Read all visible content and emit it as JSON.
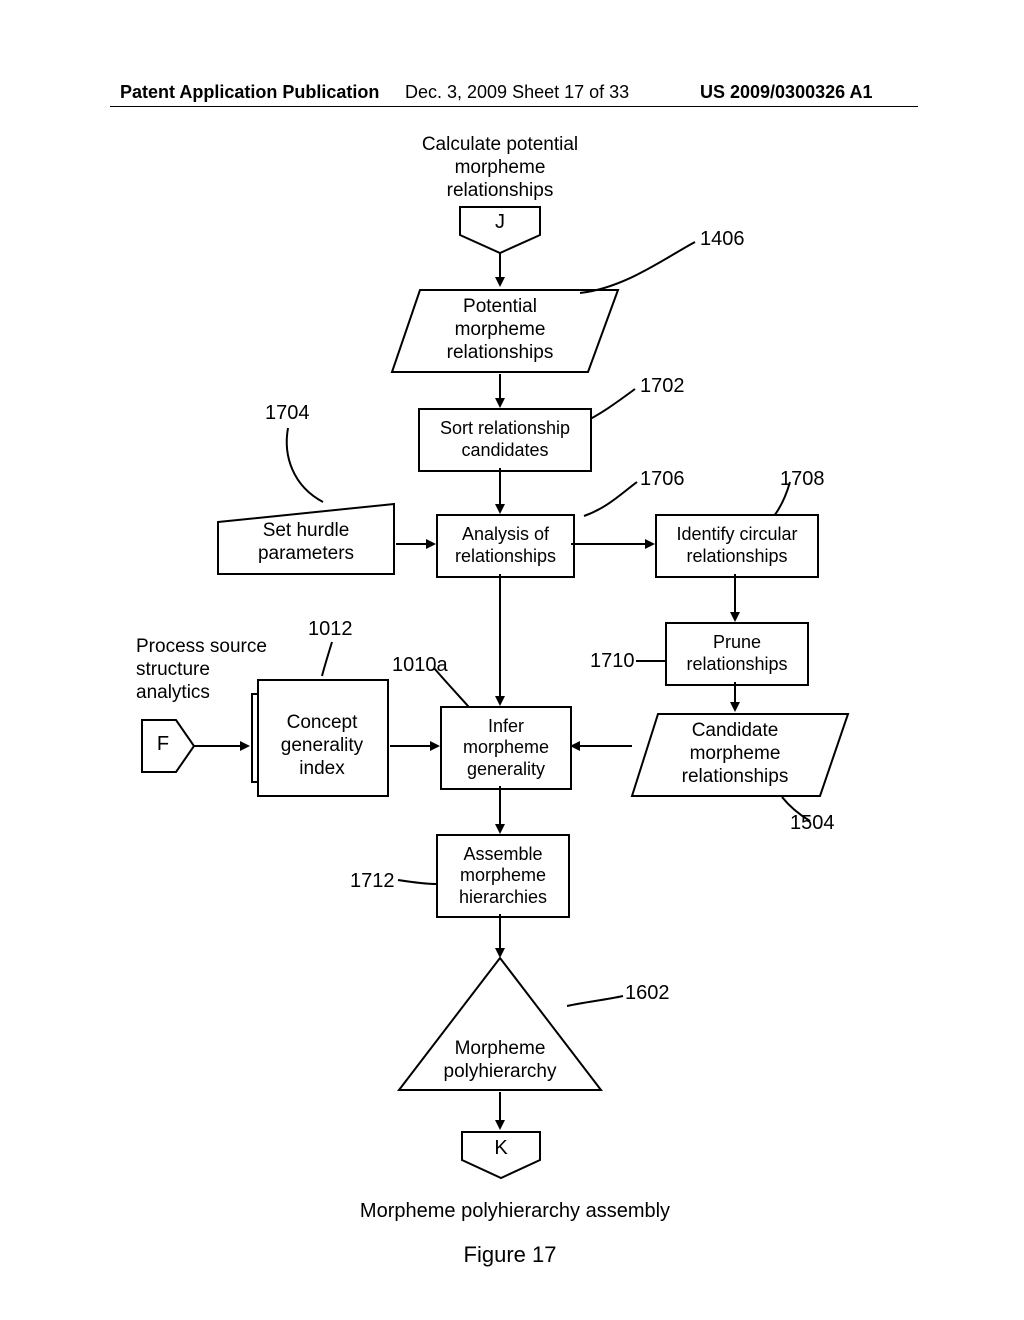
{
  "header": {
    "left": "Patent Application Publication",
    "mid": "Dec. 3, 2009   Sheet 17 of 33",
    "right": "US 2009/0300326 A1"
  },
  "nodes": {
    "title_top": "Calculate potential\nmorpheme\nrelationships",
    "conn_J": "J",
    "potential_rel": "Potential\nmorpheme\nrelationships",
    "sort_cand": "Sort relationship\ncandidates",
    "set_hurdle": "Set hurdle\nparameters",
    "analysis_rel": "Analysis of\nrelationships",
    "identify_circ": "Identify circular\nrelationships",
    "prune_rel": "Prune\nrelationships",
    "process_src": "Process source\nstructure\nanalytics",
    "conn_F": "F",
    "concept_gen": "Concept\ngenerality\nindex",
    "infer_gen": "Infer\nmorpheme\ngenerality",
    "candidate_rel": "Candidate\nmorpheme\nrelationships",
    "assemble_hier": "Assemble\nmorpheme\nhierarchies",
    "morph_poly": "Morpheme\npolyhierarchy",
    "conn_K": "K"
  },
  "refnums": {
    "r1406": "1406",
    "r1702": "1702",
    "r1704": "1704",
    "r1706": "1706",
    "r1708": "1708",
    "r1012": "1012",
    "r1010a": "1010a",
    "r1710": "1710",
    "r1504": "1504",
    "r1712": "1712",
    "r1602": "1602"
  },
  "caption": {
    "subtitle": "Morpheme polyhierarchy assembly",
    "fig": "Figure 17"
  }
}
